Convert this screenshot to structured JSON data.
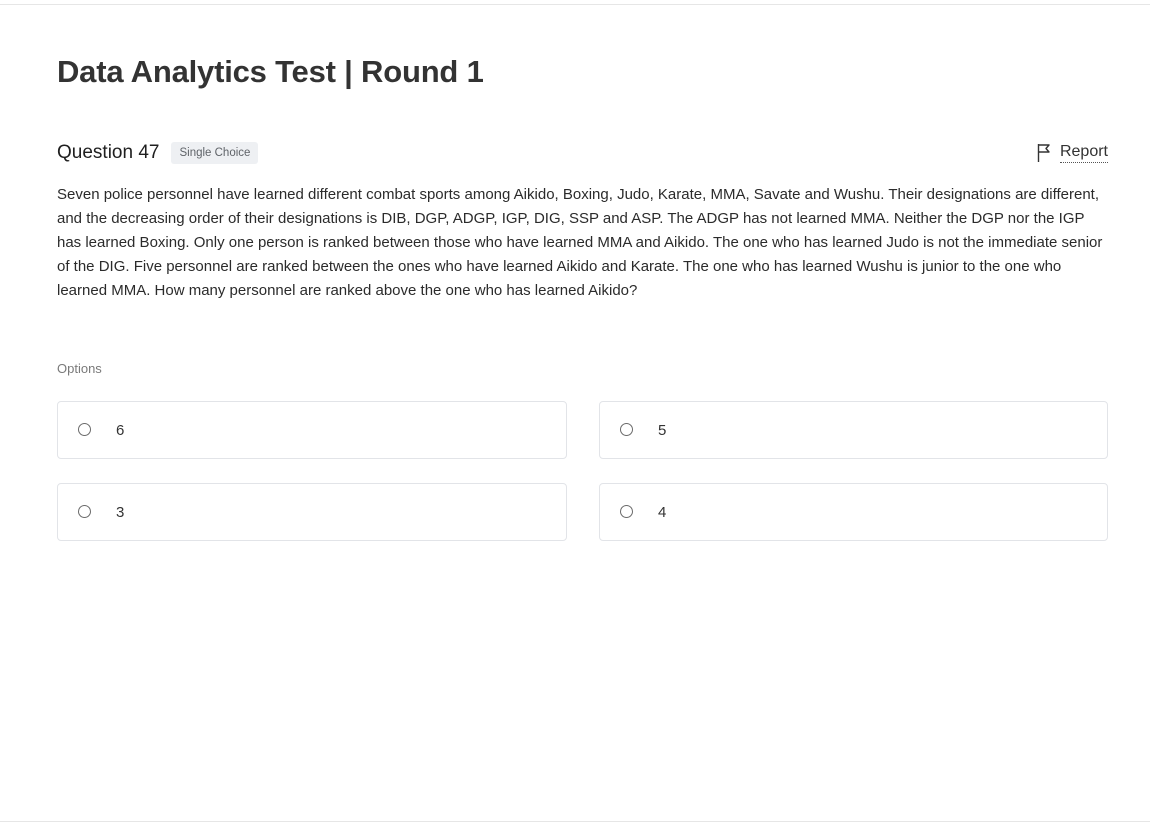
{
  "page": {
    "title": "Data Analytics Test | Round 1"
  },
  "question": {
    "number_label": "Question 47",
    "type_badge": "Single Choice",
    "report_label": "Report",
    "report_icon": "flag-icon",
    "text": "Seven police personnel have learned different combat sports among Aikido, Boxing, Judo, Karate, MMA, Savate and Wushu. Their designations are different, and the decreasing order of their designations is DIB, DGP, ADGP, IGP, DIG, SSP and ASP. The ADGP has not learned MMA. Neither the DGP nor the IGP has learned Boxing. Only one person is ranked between those who have learned MMA and Aikido. The one who has learned Judo is not the immediate senior of the DIG. Five personnel are ranked between the ones who have learned Aikido and Karate. The one who has learned Wushu is junior to the one who learned MMA. How many personnel are ranked above the one who has learned Aikido?"
  },
  "options": {
    "label": "Options",
    "items": [
      {
        "value": "6",
        "selected": false
      },
      {
        "value": "5",
        "selected": false
      },
      {
        "value": "3",
        "selected": false
      },
      {
        "value": "4",
        "selected": false
      }
    ]
  }
}
